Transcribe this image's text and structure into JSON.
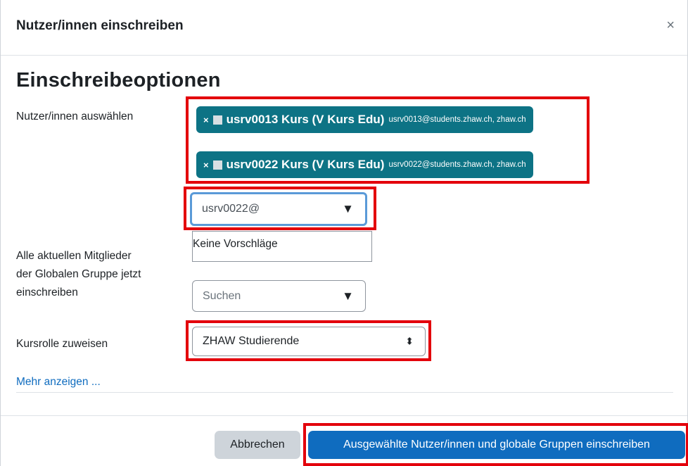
{
  "dialog": {
    "title": "Nutzer/innen einschreiben",
    "close_symbol": "×",
    "section_title": "Einschreibeoptionen"
  },
  "fields": {
    "select_users_label": "Nutzer/innen auswählen",
    "selected_users": [
      {
        "remove": "×",
        "name": "usrv0013 Kurs (V Kurs Edu)",
        "email": "usrv0013@students.zhaw.ch, zhaw.ch"
      },
      {
        "remove": "×",
        "name": "usrv0022 Kurs (V Kurs Edu)",
        "email": "usrv0022@students.zhaw.ch, zhaw.ch"
      }
    ],
    "user_search_value": "usrv0022@",
    "suggestions_text": "Keine Vorschläge",
    "global_group_label_lines": [
      "Alle aktuellen Mitglieder",
      "der Globalen Gruppe jetzt",
      "einschreiben"
    ],
    "global_group_placeholder": "Suchen",
    "course_role_label": "Kursrolle zuweisen",
    "course_role_value": "ZHAW Studierende",
    "show_more_link": "Mehr anzeigen ..."
  },
  "buttons": {
    "cancel": "Abbrechen",
    "submit": "Ausgewählte Nutzer/innen und globale Gruppen einschreiben"
  },
  "icons": {
    "dropdown_arrow": "▼",
    "select_updown": "⬍"
  },
  "colors": {
    "chip_bg": "#0d7385",
    "primary": "#0f6cbf",
    "highlight_box": "#e3000b",
    "focus_border": "#5a9ad8"
  }
}
